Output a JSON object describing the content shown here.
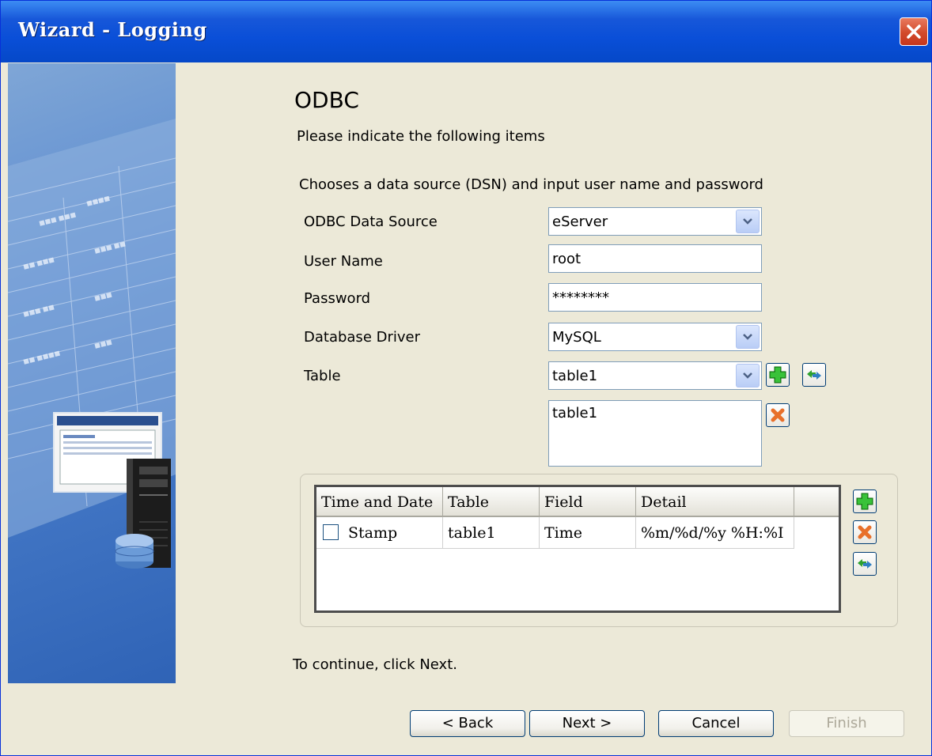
{
  "window": {
    "title": "Wizard - Logging"
  },
  "page": {
    "heading": "ODBC",
    "subtitle": "Please indicate the following items",
    "section_label": "Chooses a data source (DSN) and input user name and password"
  },
  "fields": {
    "odbc_source": {
      "label": "ODBC Data Source",
      "value": "eServer"
    },
    "user_name": {
      "label": "User Name",
      "value": "root"
    },
    "password": {
      "label": "Password",
      "value": "********"
    },
    "db_driver": {
      "label": "Database Driver",
      "value": "MySQL"
    },
    "table": {
      "label": "Table",
      "value": "table1"
    }
  },
  "table_list": {
    "items": [
      "table1"
    ]
  },
  "grid": {
    "headers": [
      "Time and Date",
      "Table",
      "Field",
      "Detail"
    ],
    "rows": [
      {
        "checked": false,
        "time_and_date": "Stamp",
        "table": "table1",
        "field": "Time",
        "detail": "%m/%d/%y %H:%I"
      }
    ]
  },
  "footer": {
    "instruction": "To continue, click Next."
  },
  "buttons": {
    "back": "< Back",
    "next": "Next >",
    "cancel": "Cancel",
    "finish": "Finish"
  },
  "colors": {
    "titlebar": "#0a4fd8",
    "dialog_bg": "#ece9d8",
    "close": "#d24a2a",
    "add_green": "#2fb12f",
    "delete_orange": "#e8702a"
  }
}
